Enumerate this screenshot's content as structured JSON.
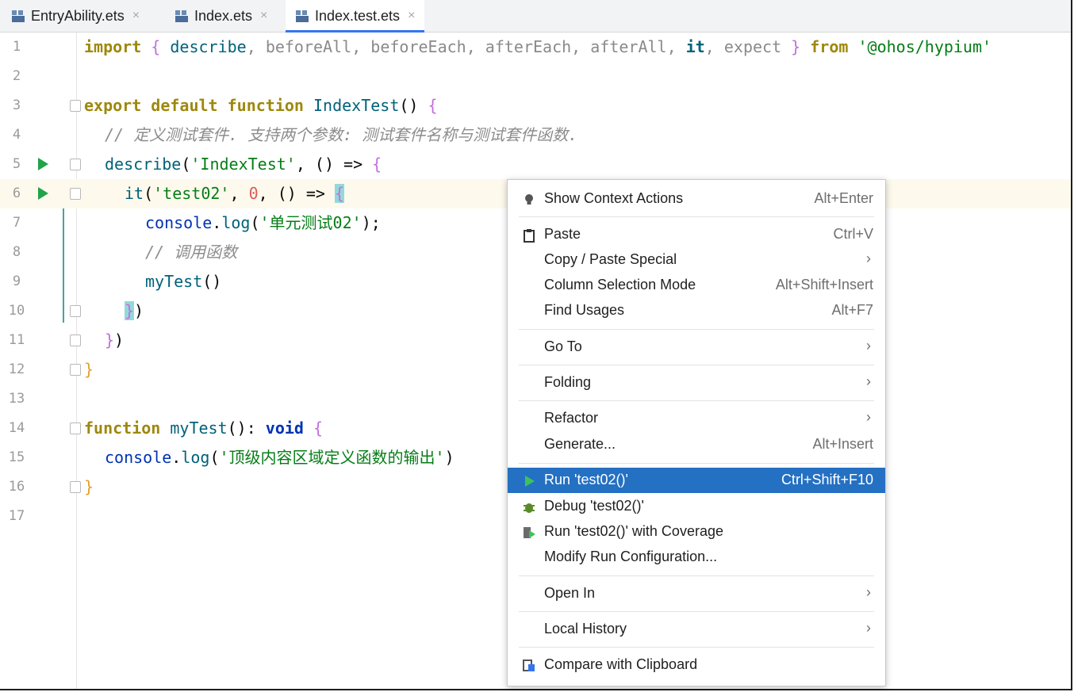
{
  "tabs": [
    {
      "label": "EntryAbility.ets",
      "active": false
    },
    {
      "label": "Index.ets",
      "active": false
    },
    {
      "label": "Index.test.ets",
      "active": true
    }
  ],
  "editor": {
    "line_numbers": [
      "1",
      "2",
      "3",
      "4",
      "5",
      "6",
      "7",
      "8",
      "9",
      "10",
      "11",
      "12",
      "13",
      "14",
      "15",
      "16",
      "17"
    ],
    "lines": {
      "l1": {
        "import": "import",
        "b1": "{",
        "describe": "describe",
        "sep1": ",",
        "beforeAll": "beforeAll",
        "sep2": ",",
        "beforeEach": "beforeEach",
        "sep3": ",",
        "afterEach": "afterEach",
        "sep4": ",",
        "afterAll": "afterAll",
        "sep5": ",",
        "it": "it",
        "sep6": ",",
        "expect": "expect",
        "b2": "}",
        "from": "from",
        "module": "'@ohos/hypium'"
      },
      "l3": {
        "kw1": "export default function",
        "name": "IndexTest",
        "paren": "()",
        "brace": "{"
      },
      "l4": {
        "comment": "// 定义测试套件. 支持两个参数: 测试套件名称与测试套件函数."
      },
      "l5": {
        "fn": "describe",
        "open": "(",
        "str": "'IndexTest'",
        "rest": ", () => ",
        "brace": "{"
      },
      "l6": {
        "fn": "it",
        "open": "(",
        "str": "'test02'",
        "comma1": ", ",
        "num": "0",
        "rest": ", () => ",
        "brace": "{"
      },
      "l7": {
        "obj": "console",
        "dot": ".",
        "fn": "log",
        "open": "(",
        "str": "'单元测试02'",
        "close": ");"
      },
      "l8": {
        "comment": "// 调用函数"
      },
      "l9": {
        "fn": "myTest",
        "paren": "()"
      },
      "l10": {
        "brace": "}",
        "paren": ")"
      },
      "l11": {
        "brace": "}",
        "paren": ")"
      },
      "l12": {
        "brace": "}"
      },
      "l14": {
        "kw": "function",
        "name": "myTest",
        "sig": "(): ",
        "type": "void",
        "brace": "{"
      },
      "l15": {
        "obj": "console",
        "dot": ".",
        "fn": "log",
        "open": "(",
        "str": "'顶级内容区域定义函数的输出'",
        "close": ")"
      },
      "l16": {
        "brace": "}"
      }
    }
  },
  "context_menu": {
    "items": [
      {
        "id": "show-context-actions",
        "label": "Show Context Actions",
        "shortcut": "Alt+Enter",
        "icon": "bulb-icon"
      },
      {
        "id": "paste",
        "label": "Paste",
        "shortcut": "Ctrl+V",
        "icon": "clipboard-icon"
      },
      {
        "id": "copy-paste-special",
        "label": "Copy / Paste Special",
        "submenu": true
      },
      {
        "id": "column-selection-mode",
        "label": "Column Selection Mode",
        "shortcut": "Alt+Shift+Insert"
      },
      {
        "id": "find-usages",
        "label": "Find Usages",
        "shortcut": "Alt+F7"
      },
      {
        "id": "go-to",
        "label": "Go To",
        "submenu": true
      },
      {
        "id": "folding",
        "label": "Folding",
        "submenu": true
      },
      {
        "id": "refactor",
        "label": "Refactor",
        "submenu": true
      },
      {
        "id": "generate",
        "label": "Generate...",
        "shortcut": "Alt+Insert"
      },
      {
        "id": "run",
        "label": "Run 'test02()'",
        "shortcut": "Ctrl+Shift+F10",
        "icon": "run-icon",
        "selected": true
      },
      {
        "id": "debug",
        "label": "Debug 'test02()'",
        "icon": "debug-icon"
      },
      {
        "id": "run-coverage",
        "label": "Run 'test02()' with Coverage",
        "icon": "coverage-icon"
      },
      {
        "id": "modify-run-config",
        "label": "Modify Run Configuration..."
      },
      {
        "id": "open-in",
        "label": "Open In",
        "submenu": true
      },
      {
        "id": "local-history",
        "label": "Local History",
        "submenu": true
      },
      {
        "id": "compare-clipboard",
        "label": "Compare with Clipboard",
        "icon": "compare-icon"
      }
    ],
    "submenu_arrow": "›"
  },
  "colors": {
    "accent": "#2470c2",
    "run": "#21a34a",
    "debug": "#5b8a2a"
  }
}
